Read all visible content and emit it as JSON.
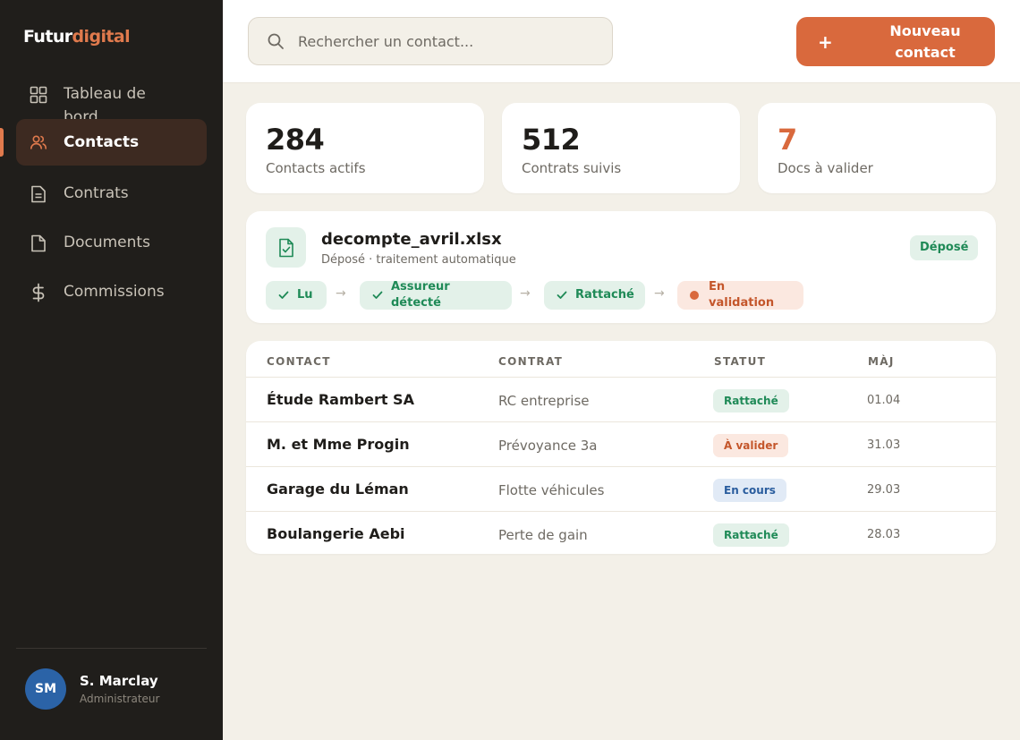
{
  "app": {
    "logo_part1": "Futur",
    "logo_part2": "digital"
  },
  "sidebar": {
    "items": [
      {
        "label": "Tableau de bord",
        "icon": "grid-icon",
        "active": false
      },
      {
        "label": "Contacts",
        "icon": "users-icon",
        "active": true
      },
      {
        "label": "Contrats",
        "icon": "file-text-icon",
        "active": false
      },
      {
        "label": "Documents",
        "icon": "document-icon",
        "active": false
      },
      {
        "label": "Commissions",
        "icon": "currency-icon",
        "active": false
      }
    ],
    "user": {
      "initials": "SM",
      "name": "S. Marclay",
      "role": "Administrateur"
    }
  },
  "topbar": {
    "search_placeholder": "Rechercher un contact...",
    "new_button_label": "Nouveau contact",
    "new_button_icon": "+"
  },
  "stats": [
    {
      "value": "284",
      "label": "Contacts actifs"
    },
    {
      "value": "512",
      "label": "Contrats suivis"
    },
    {
      "value": "7",
      "label": "Docs à valider"
    }
  ],
  "document": {
    "filename": "decompte_avril.xlsx",
    "subtitle": "Déposé · traitement automatique",
    "badge": "Déposé",
    "steps": [
      {
        "label": "Lu",
        "state": "done"
      },
      {
        "label": "Assureur détecté",
        "state": "done"
      },
      {
        "label": "Rattaché",
        "state": "done"
      },
      {
        "label": "En validation",
        "state": "pending"
      }
    ],
    "arrow": "→"
  },
  "table": {
    "headers": [
      "CONTACT",
      "CONTRAT",
      "STATUT",
      "MÀJ"
    ],
    "rows": [
      {
        "contact": "Étude Rambert SA",
        "contrat": "RC entreprise",
        "statut": "Rattaché",
        "maj": "01.04"
      },
      {
        "contact": "M. et Mme Progin",
        "contrat": "Prévoyance 3a",
        "statut": "À valider",
        "maj": "31.03"
      },
      {
        "contact": "Garage du Léman",
        "contrat": "Flotte véhicules",
        "statut": "En cours",
        "maj": "29.03"
      },
      {
        "contact": "Boulangerie Aebi",
        "contrat": "Perte de gain",
        "statut": "Rattaché",
        "maj": "28.03"
      }
    ]
  },
  "colors": {
    "accent": "#d9693d",
    "sidebar_bg": "#201e1b",
    "success": "#1f8a57",
    "warning": "#c4562b",
    "info": "#2a5d9e"
  }
}
